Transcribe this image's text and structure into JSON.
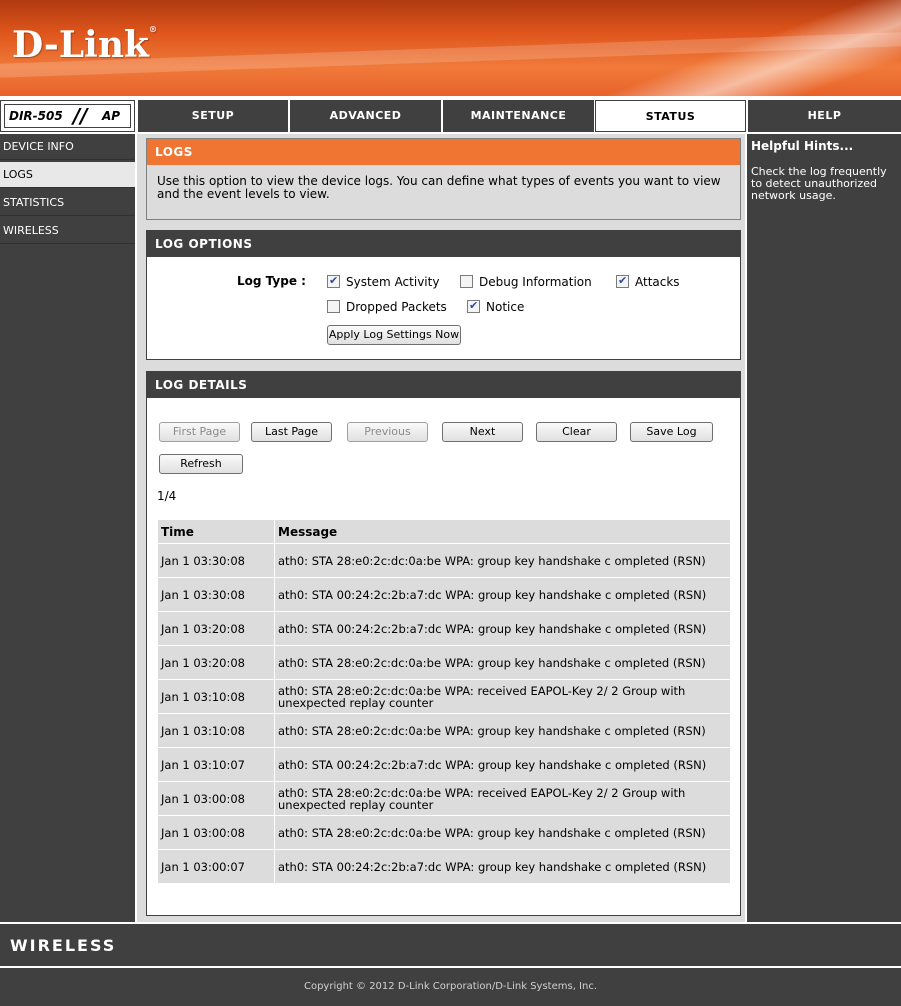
{
  "header": {
    "logo": "D-Link",
    "logo_mark": "®"
  },
  "model": {
    "name": "DIR-505",
    "separator": "//",
    "mode": "AP"
  },
  "tabs": [
    {
      "label": "SETUP"
    },
    {
      "label": "ADVANCED"
    },
    {
      "label": "MAINTENANCE"
    },
    {
      "label": "STATUS"
    },
    {
      "label": "HELP"
    }
  ],
  "sidebar": {
    "items": [
      {
        "label": "DEVICE INFO"
      },
      {
        "label": "LOGS"
      },
      {
        "label": "STATISTICS"
      },
      {
        "label": "WIRELESS"
      }
    ]
  },
  "logs": {
    "title": "LOGS",
    "description": "Use this option to view the device logs. You can define what types of events you want to view and the event levels to view."
  },
  "log_options": {
    "title": "LOG OPTIONS",
    "log_type_label": "Log Type :",
    "options": [
      {
        "label": "System Activity",
        "checked": true
      },
      {
        "label": "Debug Information",
        "checked": false
      },
      {
        "label": "Attacks",
        "checked": true
      },
      {
        "label": "Dropped Packets",
        "checked": false
      },
      {
        "label": "Notice",
        "checked": true
      }
    ],
    "apply_label": "Apply Log Settings Now"
  },
  "log_details": {
    "title": "LOG DETAILS",
    "buttons": {
      "first": "First Page",
      "last": "Last Page",
      "previous": "Previous",
      "next": "Next",
      "clear": "Clear",
      "save": "Save Log",
      "refresh": "Refresh"
    },
    "page_indicator": "1/4",
    "columns": {
      "time": "Time",
      "message": "Message"
    },
    "rows": [
      {
        "time": "Jan 1 03:30:08",
        "message": "ath0: STA 28:e0:2c:dc:0a:be WPA: group key handshake c ompleted (RSN)"
      },
      {
        "time": "Jan 1 03:30:08",
        "message": "ath0: STA 00:24:2c:2b:a7:dc WPA: group key handshake c ompleted (RSN)"
      },
      {
        "time": "Jan 1 03:20:08",
        "message": "ath0: STA 00:24:2c:2b:a7:dc WPA: group key handshake c ompleted (RSN)"
      },
      {
        "time": "Jan 1 03:20:08",
        "message": "ath0: STA 28:e0:2c:dc:0a:be WPA: group key handshake c ompleted (RSN)"
      },
      {
        "time": "Jan 1 03:10:08",
        "message": "ath0: STA 28:e0:2c:dc:0a:be WPA: received EAPOL-Key 2/ 2 Group with unexpected replay counter"
      },
      {
        "time": "Jan 1 03:10:08",
        "message": "ath0: STA 28:e0:2c:dc:0a:be WPA: group key handshake c ompleted (RSN)"
      },
      {
        "time": "Jan 1 03:10:07",
        "message": "ath0: STA 00:24:2c:2b:a7:dc WPA: group key handshake c ompleted (RSN)"
      },
      {
        "time": "Jan 1 03:00:08",
        "message": "ath0: STA 28:e0:2c:dc:0a:be WPA: received EAPOL-Key 2/ 2 Group with unexpected replay counter"
      },
      {
        "time": "Jan 1 03:00:08",
        "message": "ath0: STA 28:e0:2c:dc:0a:be WPA: group key handshake c ompleted (RSN)"
      },
      {
        "time": "Jan 1 03:00:07",
        "message": "ath0: STA 00:24:2c:2b:a7:dc WPA: group key handshake c ompleted (RSN)"
      }
    ]
  },
  "help": {
    "title": "Helpful Hints...",
    "text": "Check the log frequently to detect unauthorized network usage."
  },
  "brand_bar": {
    "label": "WIRELESS"
  },
  "footer": {
    "copyright": "Copyright © 2012 D-Link Corporation/D-Link Systems, Inc."
  },
  "colors": {
    "header_orange": "#e8622a",
    "dark_gray": "#404040",
    "logs_title_orange": "#f07532",
    "panel_gray": "#dcdcdc"
  }
}
